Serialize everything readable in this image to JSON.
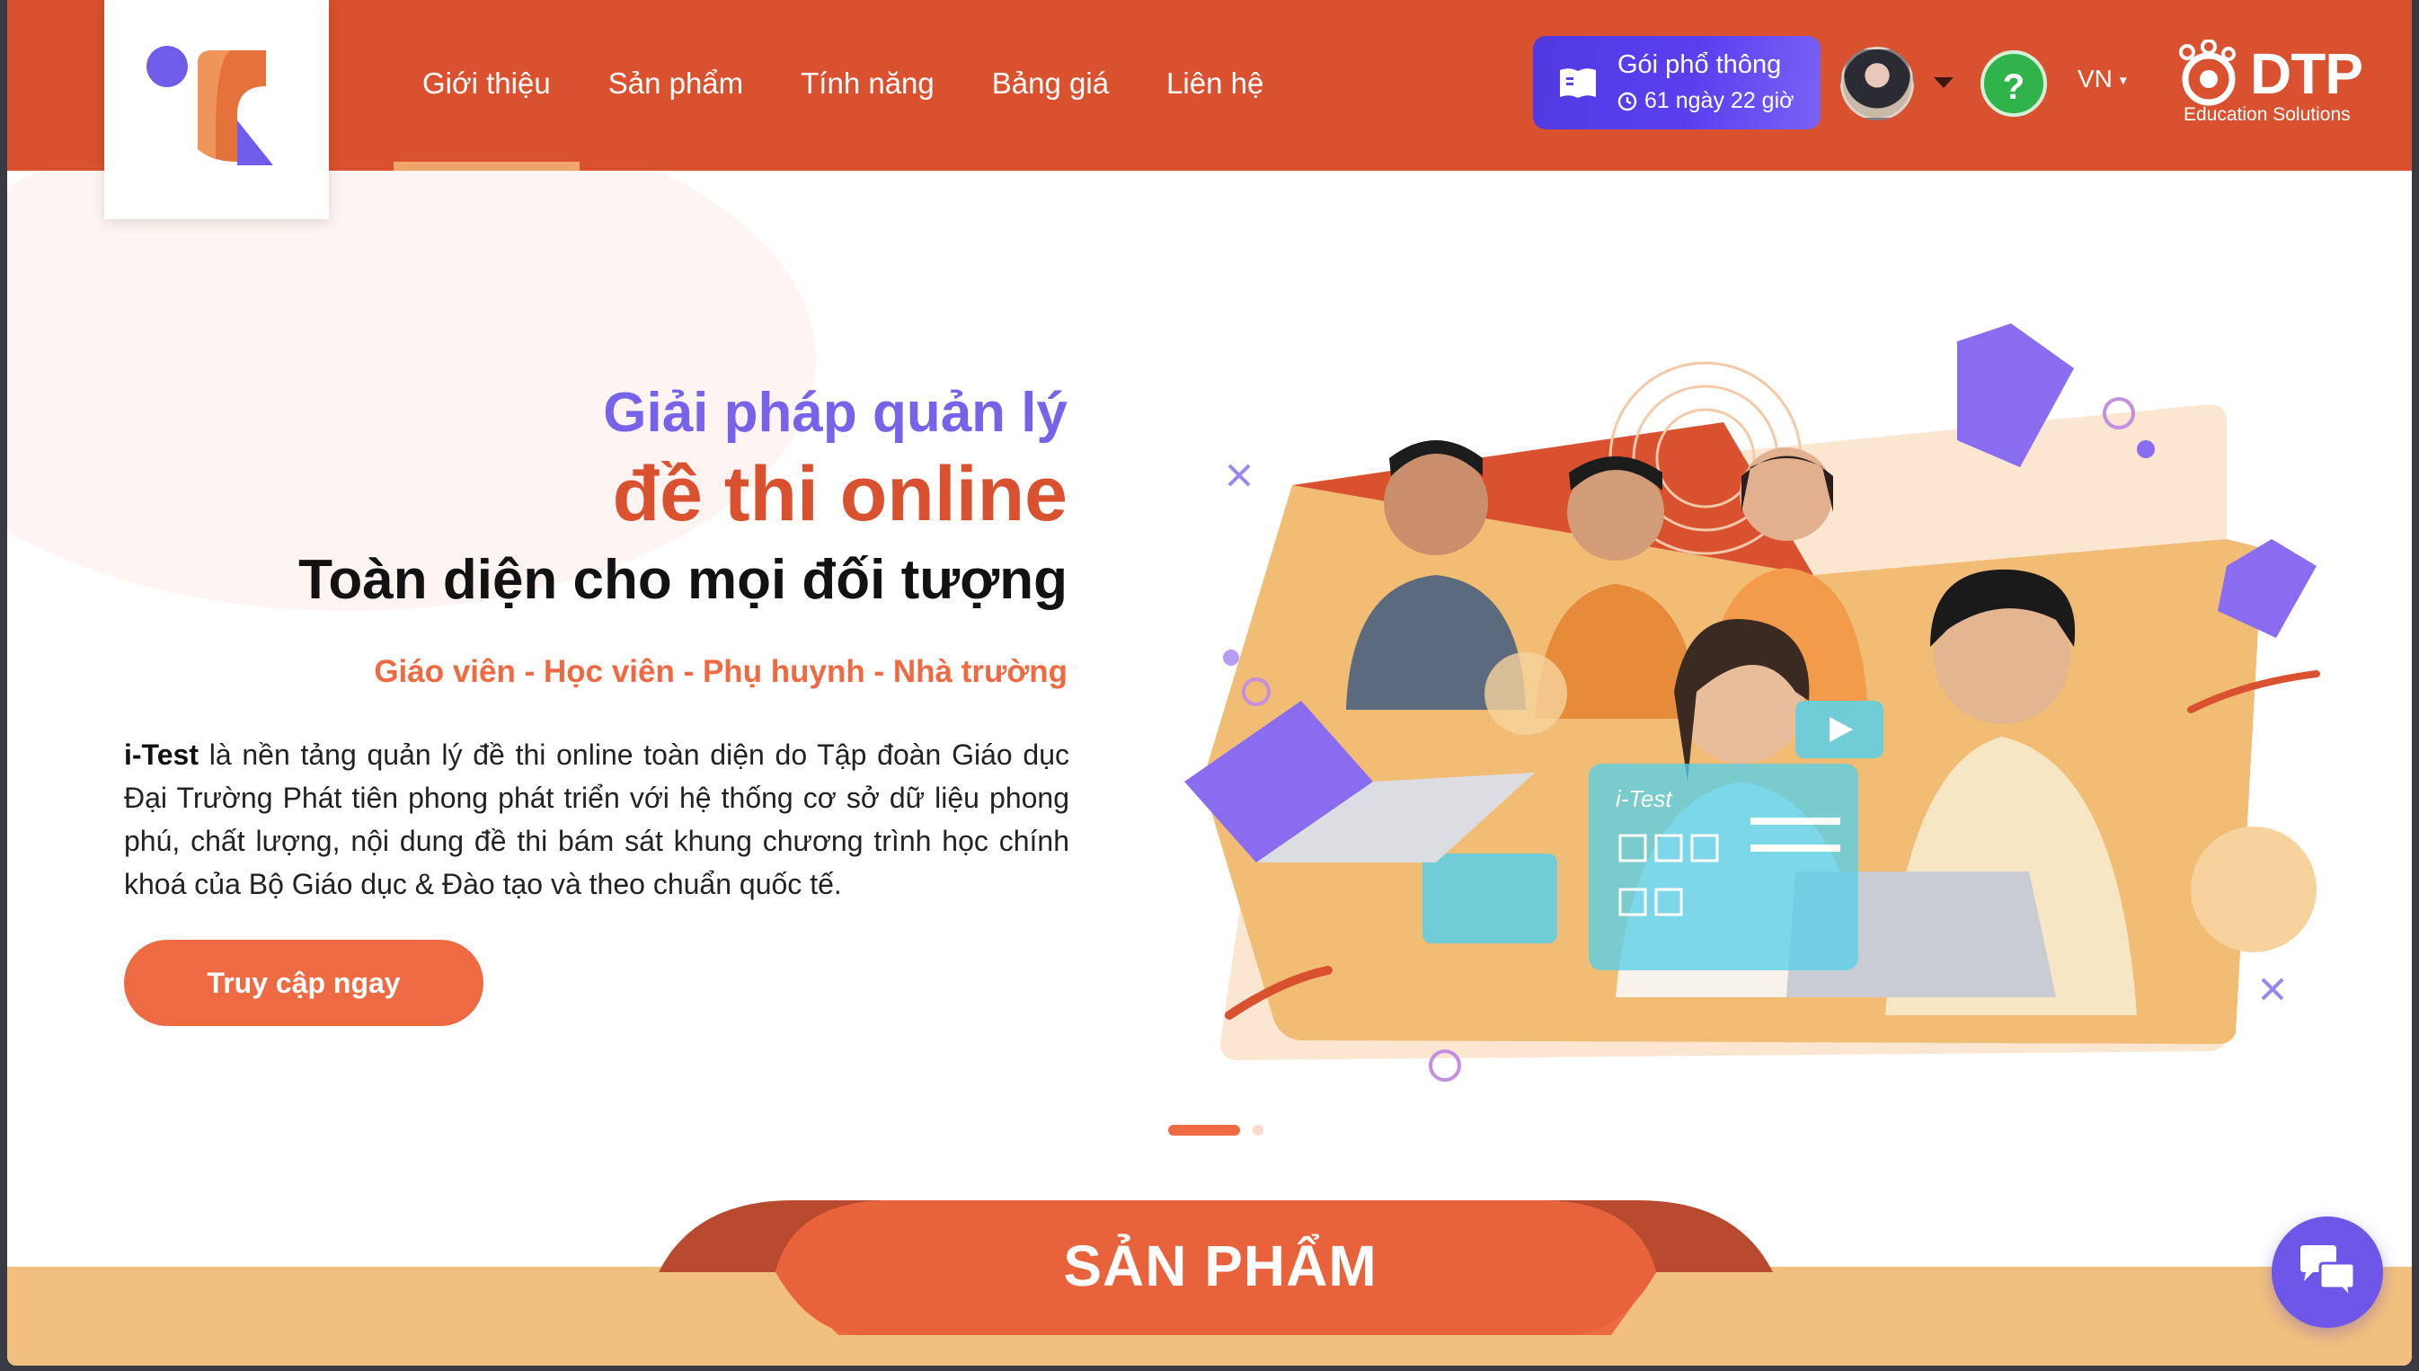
{
  "header": {
    "nav": [
      {
        "label": "Giới thiệu",
        "active": true
      },
      {
        "label": "Sản phẩm",
        "active": false
      },
      {
        "label": "Tính năng",
        "active": false
      },
      {
        "label": "Bảng giá",
        "active": false
      },
      {
        "label": "Liên hệ",
        "active": false
      }
    ],
    "plan": {
      "name": "Gói phổ thông",
      "remaining": "61 ngày 22 giờ"
    },
    "help_symbol": "?",
    "language": "VN",
    "brand": {
      "word": "DTP",
      "tagline": "Education Solutions"
    }
  },
  "hero": {
    "title_line1": "Giải pháp quản lý",
    "title_line2": "đề thi online",
    "title_line3": "Toàn diện cho mọi đối tượng",
    "audience": "Giáo viên - Học viên - Phụ huynh - Nhà trường",
    "desc_brand": "i-Test",
    "desc_rest": " là nền tảng quản lý đề thi online toàn diện do Tập đoàn Giáo dục Đại Trường Phát tiên phong phát triển với hệ thống cơ sở dữ liệu phong phú, chất lượng, nội dung đề thi bám sát khung chương trình học chính khoá của Bộ Giáo dục & Đào tạo và theo chuẩn quốc tế.",
    "cta_label": "Truy cập ngay",
    "illustration_label": "i-Test"
  },
  "carousel": {
    "slides": 2,
    "active_index": 0
  },
  "products_section": {
    "title": "SẢN PHẨM"
  },
  "icons": {
    "plan": "book-icon",
    "clock": "clock-icon",
    "help": "help-icon",
    "chat": "chat-bubbles-icon",
    "caret": "caret-down-icon"
  },
  "colors": {
    "header": "#d9512f",
    "accent_orange": "#ee6a42",
    "accent_purple": "#7763ea",
    "plan_button": "#5a3ff0",
    "help_green": "#2fb34a",
    "band": "#f2c07e"
  }
}
